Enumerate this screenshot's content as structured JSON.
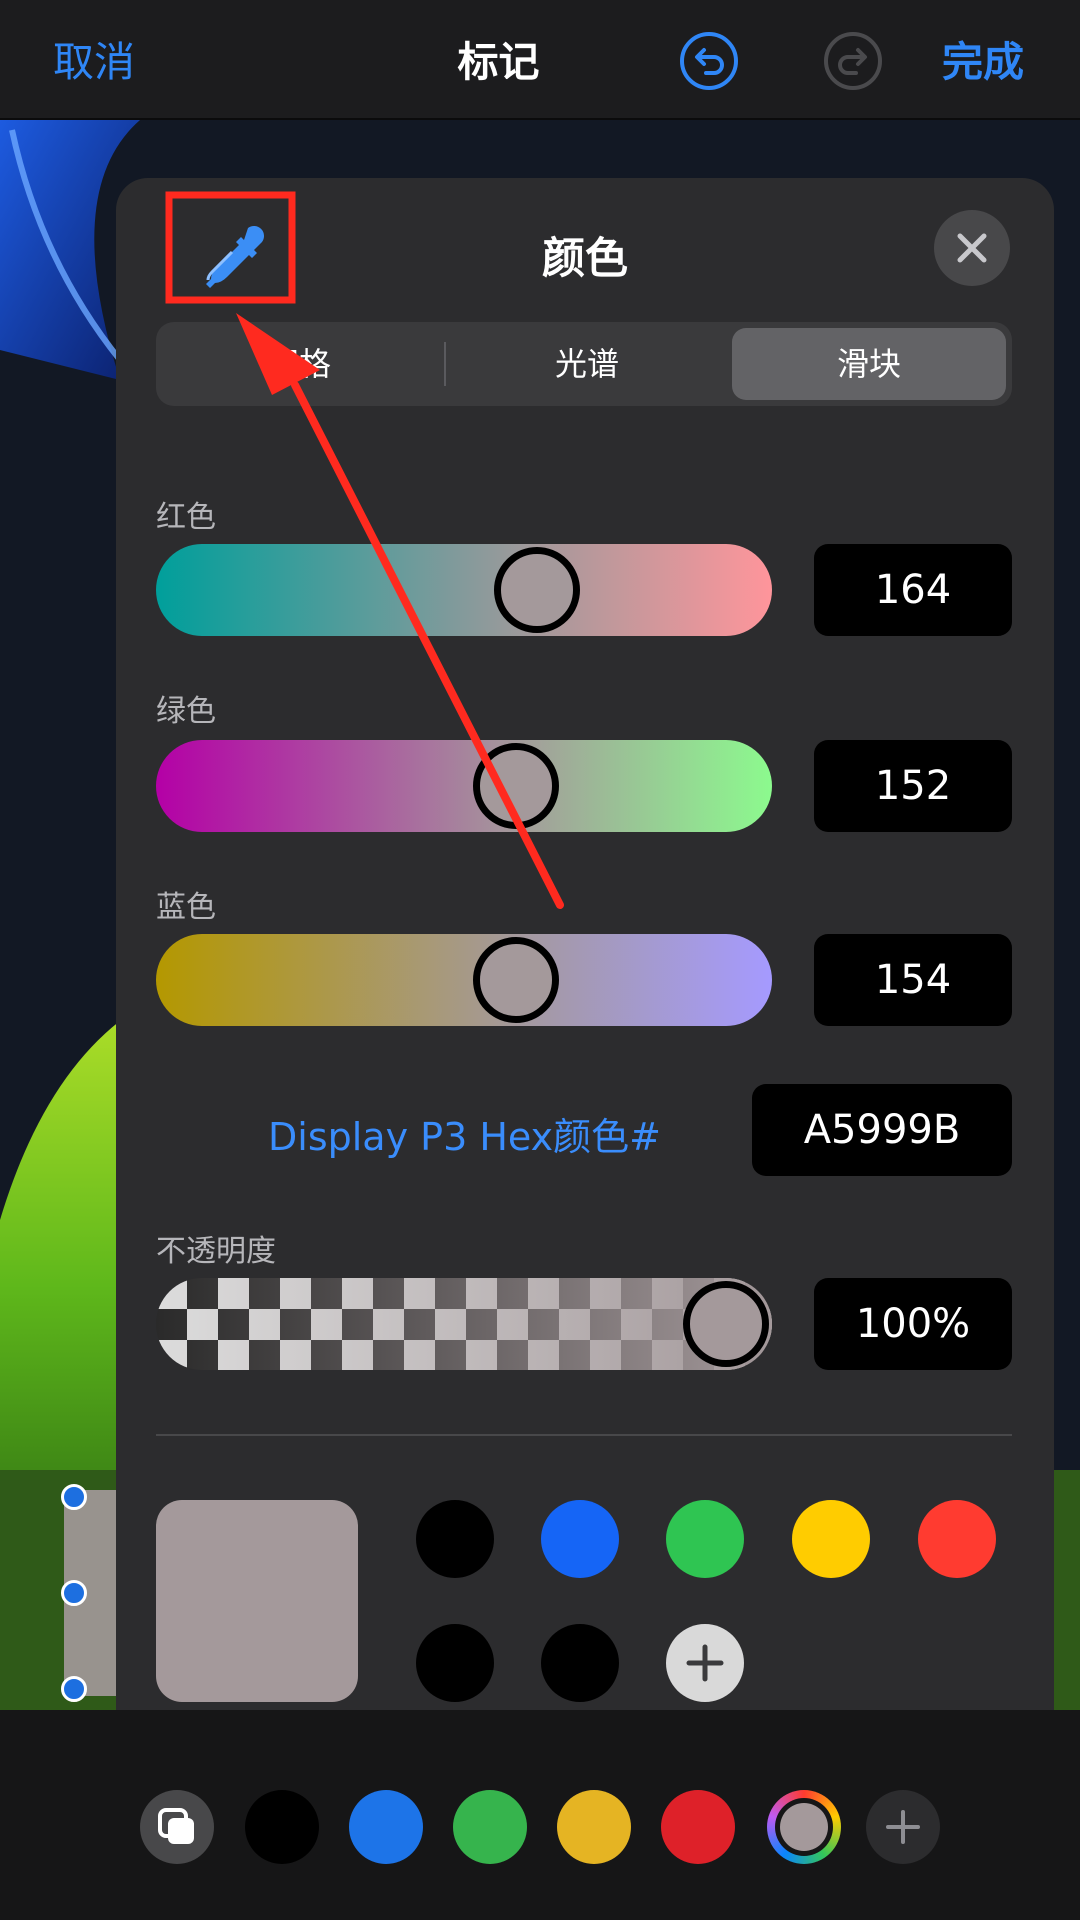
{
  "nav": {
    "cancel_label": "取消",
    "title": "标记",
    "done_label": "完成",
    "undo_icon": "undo-icon",
    "redo_icon": "redo-icon"
  },
  "panel": {
    "title": "颜色",
    "segments": [
      "网格",
      "光谱",
      "滑块"
    ],
    "selected_segment": "滑块",
    "sliders": [
      {
        "label": "红色",
        "value": "164",
        "fraction": 0.64
      },
      {
        "label": "绿色",
        "value": "152",
        "fraction": 0.6
      },
      {
        "label": "蓝色",
        "value": "154",
        "fraction": 0.6
      }
    ],
    "hex_label": "Display P3 Hex颜色#",
    "hex_value": "A5999B",
    "opacity_label": "不透明度",
    "opacity_value": "100%",
    "opacity_fraction": 1.0,
    "current_color": "#a4999b",
    "swatches": [
      "#000000",
      "#1565f6",
      "#2fc552",
      "#ffcc00",
      "#ff3b30",
      "#000000",
      "#000000"
    ]
  },
  "toolbar": {
    "colors": [
      "#000000",
      "#1d74e8",
      "#36b44d",
      "#e5b423",
      "#de2129"
    ],
    "current_color": "#a4999b"
  },
  "colors": {
    "accent": "#2f86f6",
    "annotation": "#ff2a1f"
  }
}
